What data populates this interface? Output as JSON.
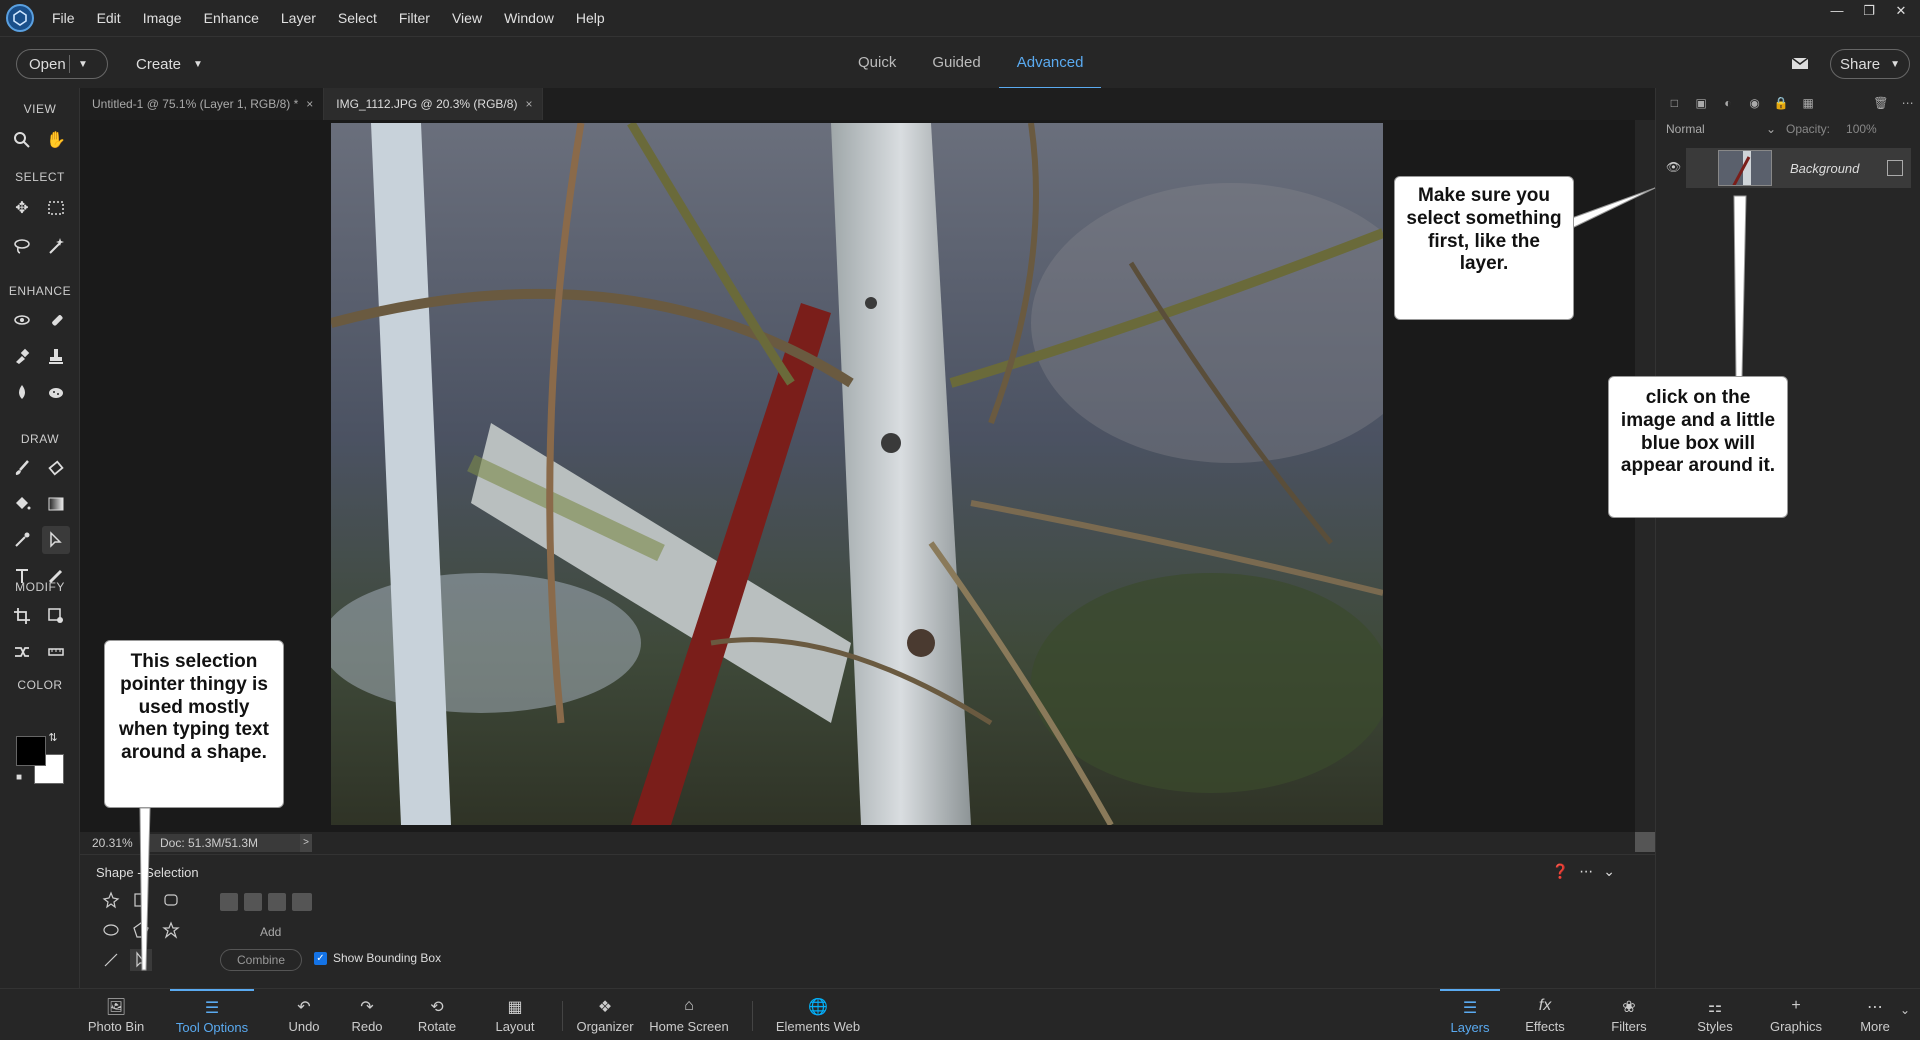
{
  "menubar": {
    "items": [
      "File",
      "Edit",
      "Image",
      "Enhance",
      "Layer",
      "Select",
      "Filter",
      "View",
      "Window",
      "Help"
    ]
  },
  "modebar": {
    "open_label": "Open",
    "create_label": "Create",
    "tabs": [
      "Quick",
      "Guided",
      "Advanced"
    ],
    "active_tab": "Advanced",
    "share_label": "Share"
  },
  "toolbox": {
    "sections": [
      "VIEW",
      "SELECT",
      "ENHANCE",
      "DRAW",
      "MODIFY",
      "COLOR"
    ],
    "foreground_color": "#000000",
    "background_color": "#ffffff"
  },
  "documents": {
    "tabs": [
      {
        "label": "Untitled-1 @ 75.1% (Layer 1, RGB/8) *",
        "close": "×"
      },
      {
        "label": "IMG_1112.JPG @ 20.3% (RGB/8)",
        "close": "×"
      }
    ],
    "active_index": 1
  },
  "status": {
    "zoom": "20.31%",
    "doc_size": "Doc: 51.3M/51.3M",
    "arrow": ">"
  },
  "tool_options": {
    "title": "Shape - Selection",
    "add_label": "Add",
    "combine_label": "Combine",
    "bounding_box_label": "Show Bounding Box",
    "bounding_box_checked": true
  },
  "layers_panel": {
    "blend_mode": "Normal",
    "opacity_label": "Opacity:",
    "opacity_value": "100%",
    "layer_name": "Background"
  },
  "callouts": {
    "layer": "Make sure you select something first, like the layer.",
    "click": "click on the image and a little blue box will appear around it.",
    "pointer": "This selection pointer thingy is used mostly when typing text around a shape."
  },
  "bottom_bar": {
    "left": [
      "Photo Bin",
      "Tool Options",
      "Undo",
      "Redo",
      "Rotate",
      "Layout",
      "Organizer",
      "Home Screen",
      "Elements Web"
    ],
    "right": [
      "Layers",
      "Effects",
      "Filters",
      "Styles",
      "Graphics",
      "More"
    ],
    "active_left": "Tool Options",
    "active_right": "Layers"
  },
  "colors": {
    "accent": "#5aaaf0",
    "panel_bg": "#262626",
    "canvas_bg": "#1a1a1a"
  }
}
